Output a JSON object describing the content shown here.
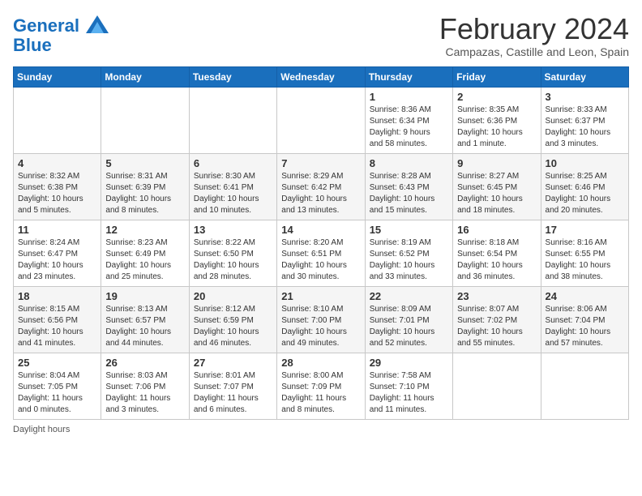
{
  "logo": {
    "line1": "General",
    "line2": "Blue"
  },
  "title": "February 2024",
  "subtitle": "Campazas, Castille and Leon, Spain",
  "days_of_week": [
    "Sunday",
    "Monday",
    "Tuesday",
    "Wednesday",
    "Thursday",
    "Friday",
    "Saturday"
  ],
  "weeks": [
    [
      {
        "day": "",
        "info": ""
      },
      {
        "day": "",
        "info": ""
      },
      {
        "day": "",
        "info": ""
      },
      {
        "day": "",
        "info": ""
      },
      {
        "day": "1",
        "info": "Sunrise: 8:36 AM\nSunset: 6:34 PM\nDaylight: 9 hours\nand 58 minutes."
      },
      {
        "day": "2",
        "info": "Sunrise: 8:35 AM\nSunset: 6:36 PM\nDaylight: 10 hours\nand 1 minute."
      },
      {
        "day": "3",
        "info": "Sunrise: 8:33 AM\nSunset: 6:37 PM\nDaylight: 10 hours\nand 3 minutes."
      }
    ],
    [
      {
        "day": "4",
        "info": "Sunrise: 8:32 AM\nSunset: 6:38 PM\nDaylight: 10 hours\nand 5 minutes."
      },
      {
        "day": "5",
        "info": "Sunrise: 8:31 AM\nSunset: 6:39 PM\nDaylight: 10 hours\nand 8 minutes."
      },
      {
        "day": "6",
        "info": "Sunrise: 8:30 AM\nSunset: 6:41 PM\nDaylight: 10 hours\nand 10 minutes."
      },
      {
        "day": "7",
        "info": "Sunrise: 8:29 AM\nSunset: 6:42 PM\nDaylight: 10 hours\nand 13 minutes."
      },
      {
        "day": "8",
        "info": "Sunrise: 8:28 AM\nSunset: 6:43 PM\nDaylight: 10 hours\nand 15 minutes."
      },
      {
        "day": "9",
        "info": "Sunrise: 8:27 AM\nSunset: 6:45 PM\nDaylight: 10 hours\nand 18 minutes."
      },
      {
        "day": "10",
        "info": "Sunrise: 8:25 AM\nSunset: 6:46 PM\nDaylight: 10 hours\nand 20 minutes."
      }
    ],
    [
      {
        "day": "11",
        "info": "Sunrise: 8:24 AM\nSunset: 6:47 PM\nDaylight: 10 hours\nand 23 minutes."
      },
      {
        "day": "12",
        "info": "Sunrise: 8:23 AM\nSunset: 6:49 PM\nDaylight: 10 hours\nand 25 minutes."
      },
      {
        "day": "13",
        "info": "Sunrise: 8:22 AM\nSunset: 6:50 PM\nDaylight: 10 hours\nand 28 minutes."
      },
      {
        "day": "14",
        "info": "Sunrise: 8:20 AM\nSunset: 6:51 PM\nDaylight: 10 hours\nand 30 minutes."
      },
      {
        "day": "15",
        "info": "Sunrise: 8:19 AM\nSunset: 6:52 PM\nDaylight: 10 hours\nand 33 minutes."
      },
      {
        "day": "16",
        "info": "Sunrise: 8:18 AM\nSunset: 6:54 PM\nDaylight: 10 hours\nand 36 minutes."
      },
      {
        "day": "17",
        "info": "Sunrise: 8:16 AM\nSunset: 6:55 PM\nDaylight: 10 hours\nand 38 minutes."
      }
    ],
    [
      {
        "day": "18",
        "info": "Sunrise: 8:15 AM\nSunset: 6:56 PM\nDaylight: 10 hours\nand 41 minutes."
      },
      {
        "day": "19",
        "info": "Sunrise: 8:13 AM\nSunset: 6:57 PM\nDaylight: 10 hours\nand 44 minutes."
      },
      {
        "day": "20",
        "info": "Sunrise: 8:12 AM\nSunset: 6:59 PM\nDaylight: 10 hours\nand 46 minutes."
      },
      {
        "day": "21",
        "info": "Sunrise: 8:10 AM\nSunset: 7:00 PM\nDaylight: 10 hours\nand 49 minutes."
      },
      {
        "day": "22",
        "info": "Sunrise: 8:09 AM\nSunset: 7:01 PM\nDaylight: 10 hours\nand 52 minutes."
      },
      {
        "day": "23",
        "info": "Sunrise: 8:07 AM\nSunset: 7:02 PM\nDaylight: 10 hours\nand 55 minutes."
      },
      {
        "day": "24",
        "info": "Sunrise: 8:06 AM\nSunset: 7:04 PM\nDaylight: 10 hours\nand 57 minutes."
      }
    ],
    [
      {
        "day": "25",
        "info": "Sunrise: 8:04 AM\nSunset: 7:05 PM\nDaylight: 11 hours\nand 0 minutes."
      },
      {
        "day": "26",
        "info": "Sunrise: 8:03 AM\nSunset: 7:06 PM\nDaylight: 11 hours\nand 3 minutes."
      },
      {
        "day": "27",
        "info": "Sunrise: 8:01 AM\nSunset: 7:07 PM\nDaylight: 11 hours\nand 6 minutes."
      },
      {
        "day": "28",
        "info": "Sunrise: 8:00 AM\nSunset: 7:09 PM\nDaylight: 11 hours\nand 8 minutes."
      },
      {
        "day": "29",
        "info": "Sunrise: 7:58 AM\nSunset: 7:10 PM\nDaylight: 11 hours\nand 11 minutes."
      },
      {
        "day": "",
        "info": ""
      },
      {
        "day": "",
        "info": ""
      }
    ]
  ],
  "footer": "Daylight hours"
}
